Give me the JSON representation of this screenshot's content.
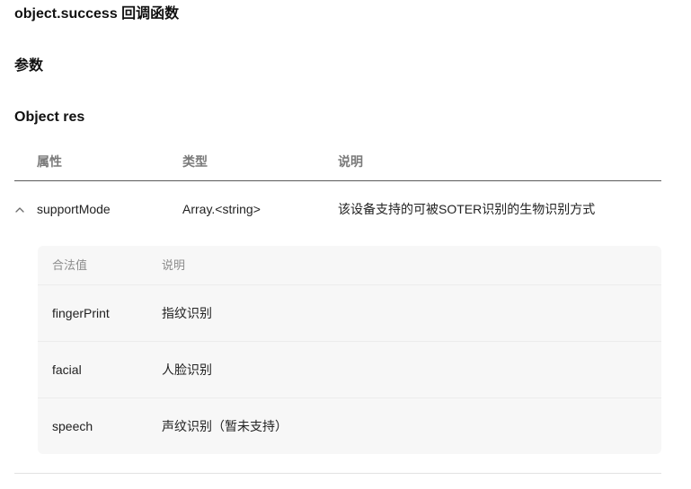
{
  "sections": {
    "callback_title": "object.success 回调函数",
    "params_title": "参数",
    "object_title": "Object res"
  },
  "table": {
    "headers": [
      "属性",
      "类型",
      "说明"
    ],
    "rows": [
      {
        "name": "supportMode",
        "type": "Array.<string>",
        "desc": "该设备支持的可被SOTER识别的生物识别方式",
        "expanded": true
      }
    ]
  },
  "subtable": {
    "headers": [
      "合法值",
      "说明"
    ],
    "rows": [
      {
        "value": "fingerPrint",
        "desc": "指纹识别"
      },
      {
        "value": "facial",
        "desc": "人脸识别"
      },
      {
        "value": "speech",
        "desc": "声纹识别（暂未支持）"
      }
    ]
  },
  "icons": {
    "toggle": "chevron-up-icon"
  }
}
